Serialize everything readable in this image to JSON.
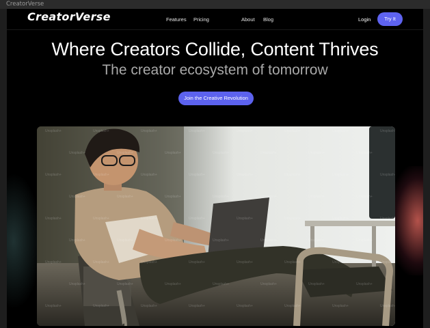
{
  "window": {
    "title": "CreatorVerse"
  },
  "nav": {
    "logo": "CreatorVerse",
    "links": [
      "Features",
      "Pricing",
      "About",
      "Blog"
    ],
    "login": "Login",
    "try_it": "Try It"
  },
  "hero": {
    "title": "Where Creators Collide, Content Thrives",
    "subtitle": "The creator ecosystem of tomorrow",
    "cta": "Join the Creative Revolution"
  },
  "image": {
    "watermark": "Unsplash+"
  },
  "colors": {
    "accent": "#5e63f0",
    "background": "#000000",
    "text": "#ffffff",
    "muted_text": "#a9a9a9"
  }
}
